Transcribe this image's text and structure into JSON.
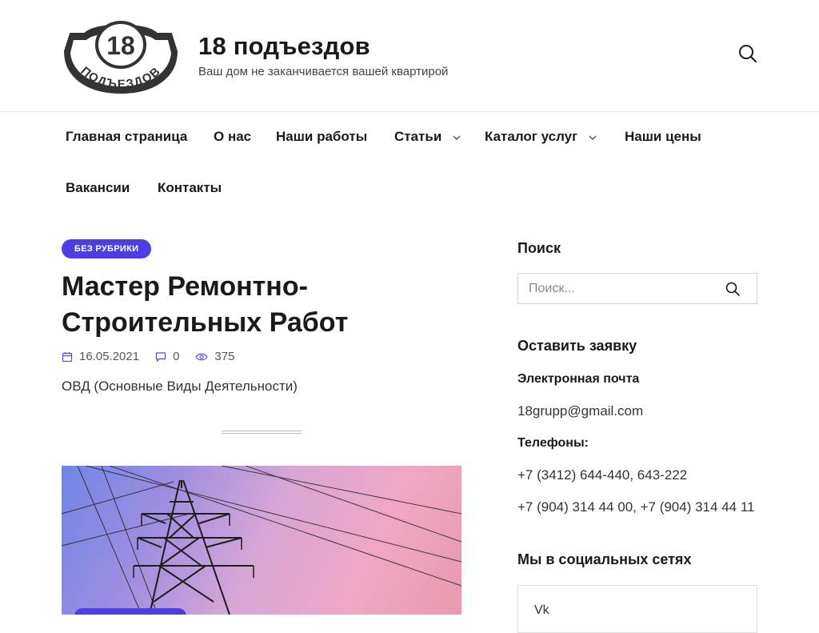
{
  "header": {
    "logo": {
      "number": "18",
      "ring_text": "ПОДЪЕЗДОВ"
    },
    "site_title": "18 подъездов",
    "site_description": "Ваш дом не заканчивается вашей квартирой",
    "search_icon": "search-icon"
  },
  "nav": {
    "items": [
      {
        "label": "Главная страница",
        "has_submenu": false
      },
      {
        "label": "О нас",
        "has_submenu": false
      },
      {
        "label": "Наши работы",
        "has_submenu": false
      },
      {
        "label": "Статьи",
        "has_submenu": true
      },
      {
        "label": "Каталог услуг",
        "has_submenu": true
      },
      {
        "label": "Наши цены",
        "has_submenu": false
      },
      {
        "label": "Вакансии",
        "has_submenu": false
      },
      {
        "label": "Контакты",
        "has_submenu": false
      }
    ]
  },
  "post": {
    "category": "БЕЗ РУБРИКИ",
    "title": "Мастер Ремонтно-Строительных Работ",
    "date": "16.05.2021",
    "comments": "0",
    "views": "375",
    "excerpt": "ОВД (Основные Виды Деятельности)"
  },
  "sidebar": {
    "search_title": "Поиск",
    "search_placeholder": "Поиск...",
    "request_title": "Оставить заявку",
    "email_label": "Электронная почта",
    "email": "18grupp@gmail.com",
    "phones_label": "Телефоны:",
    "phones_1": "+7 (3412) 644-440, 643-222",
    "phones_2": "+7 (904) 314 44 00, +7 (904) 314 44 11",
    "social_title": "Мы в социальных сетях",
    "social_first": "Vk"
  },
  "colors": {
    "accent": "#4e3ee0",
    "text": "#1a1a1a",
    "border": "#cfcfcf"
  }
}
